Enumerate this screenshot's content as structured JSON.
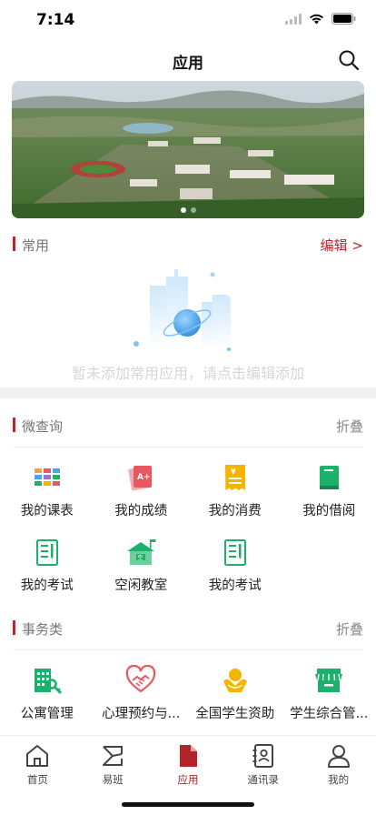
{
  "status": {
    "time": "7:14"
  },
  "nav": {
    "title": "应用"
  },
  "banner": {
    "dots": 2
  },
  "common": {
    "title": "常用",
    "action": "编辑 >",
    "empty_text": "暂未添加常用应用，请点击编辑添加"
  },
  "micro": {
    "title": "微查询",
    "action": "折叠",
    "items": [
      {
        "label": "我的课表",
        "icon": "timetable-icon"
      },
      {
        "label": "我的成绩",
        "icon": "grades-icon"
      },
      {
        "label": "我的消费",
        "icon": "consumption-receipt-icon"
      },
      {
        "label": "我的借阅",
        "icon": "book-icon"
      },
      {
        "label": "我的考试",
        "icon": "exam-icon"
      },
      {
        "label": "空闲教室",
        "icon": "classroom-icon"
      },
      {
        "label": "我的考试",
        "icon": "exam-icon"
      }
    ]
  },
  "affairs": {
    "title": "事务类",
    "action": "折叠",
    "items": [
      {
        "label": "公寓管理",
        "icon": "apartment-icon"
      },
      {
        "label": "心理预约与...",
        "icon": "handshake-heart-icon"
      },
      {
        "label": "全国学生资助",
        "icon": "student-aid-icon"
      },
      {
        "label": "学生综合管...",
        "icon": "store-icon"
      }
    ]
  },
  "tabs": [
    {
      "label": "首页",
      "icon": "home-icon"
    },
    {
      "label": "易班",
      "icon": "yiban-icon"
    },
    {
      "label": "应用",
      "icon": "apps-icon",
      "active": true
    },
    {
      "label": "通讯录",
      "icon": "contacts-icon"
    },
    {
      "label": "我的",
      "icon": "profile-icon"
    }
  ],
  "colors": {
    "accent": "#c0232a",
    "active_tab": "#b2242a",
    "green": "#1db06a",
    "red_icon": "#e8575f",
    "yellow": "#f5b400",
    "blue_illus": "#7fc4f5"
  }
}
